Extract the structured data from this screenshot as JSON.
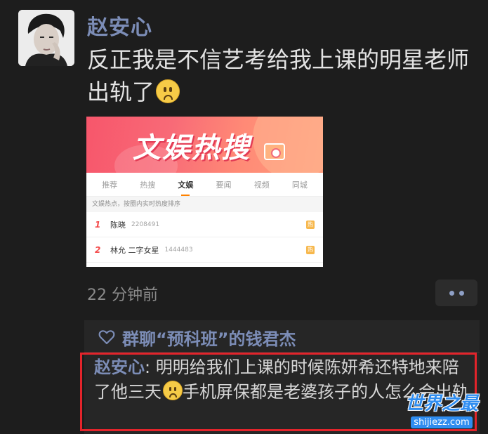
{
  "post": {
    "username": "赵安心",
    "text": "反正我是不信艺考给我上课的明星老师出轨了",
    "emoji": "sad-face",
    "timestamp": "22 分钟前"
  },
  "hot_card": {
    "title": "文娱热搜",
    "tabs": [
      "推荐",
      "热搜",
      "文娱",
      "要闻",
      "视频",
      "同城"
    ],
    "active_tab": "文娱",
    "note": "文娱热点，按圈内实时热度排序",
    "rows": [
      {
        "rank": "1",
        "keyword": "陈晓",
        "count": "2208491",
        "tag": "热"
      },
      {
        "rank": "2",
        "keyword": "林允 二字女星",
        "count": "1444483",
        "tag": "热"
      }
    ]
  },
  "likes": {
    "text": "群聊“预科班”的钱君杰"
  },
  "comment": {
    "author": "赵安心",
    "separator": ": ",
    "text_before": "明明给我们上课的时候陈妍希还特地来陪了他三天",
    "text_after": "手机屏保都是老婆孩子的人怎么会出轨"
  },
  "watermark": {
    "main": "世界之最",
    "sub": "shijiezz.com"
  },
  "colors": {
    "background": "#1d1d1d",
    "name_link": "#7c8db7",
    "highlight_box": "#e3242b"
  }
}
